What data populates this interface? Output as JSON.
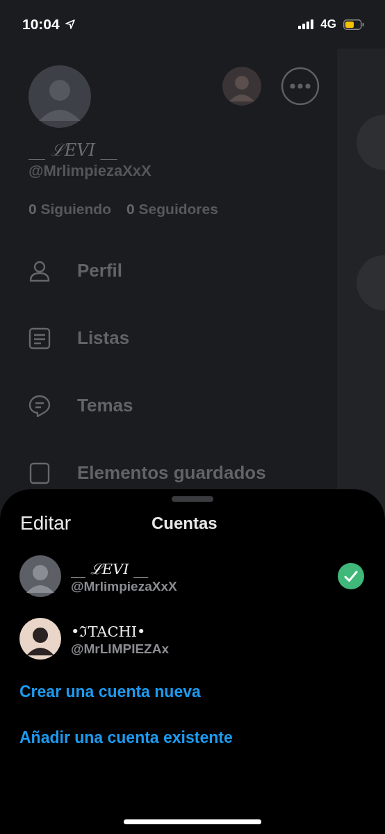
{
  "status_bar": {
    "time": "10:04",
    "network": "4G"
  },
  "drawer": {
    "display_name": "__ ℒEVI __",
    "handle": "@MrlimpiezaXxX",
    "stats": [
      {
        "count": "0",
        "label": "Siguiendo"
      },
      {
        "count": "0",
        "label": "Seguidores"
      }
    ],
    "menu": [
      {
        "label": "Perfil",
        "kind": "profile"
      },
      {
        "label": "Listas",
        "kind": "lists"
      },
      {
        "label": "Temas",
        "kind": "topics"
      },
      {
        "label": "Elementos guardados",
        "kind": "bookmarks"
      }
    ]
  },
  "sheet": {
    "edit_label": "Editar",
    "title": "Cuentas",
    "accounts": [
      {
        "display_name": "__ ℒEVI __",
        "handle": "@MrlimpiezaXxX",
        "selected": true
      },
      {
        "display_name": "•ℑTACHI•",
        "handle": "@MrLIMPIEZAx",
        "selected": false
      }
    ],
    "actions": [
      "Crear una cuenta nueva",
      "Añadir una cuenta existente"
    ]
  }
}
